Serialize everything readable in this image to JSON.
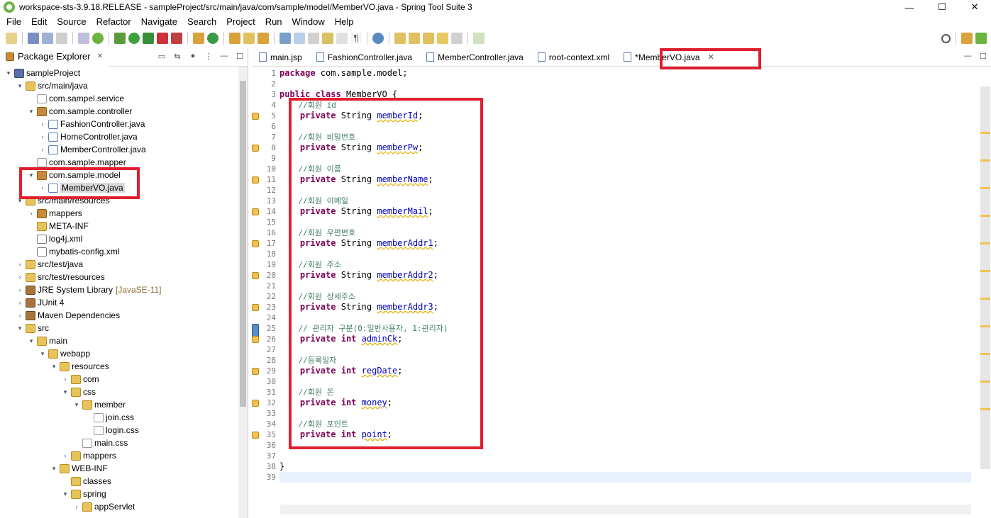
{
  "window": {
    "title": "workspace-sts-3.9.18.RELEASE - sampleProject/src/main/java/com/sample/model/MemberVO.java - Spring Tool Suite 3",
    "minimize": "—",
    "maximize": "☐",
    "close": "✕"
  },
  "menu": [
    "File",
    "Edit",
    "Source",
    "Refactor",
    "Navigate",
    "Search",
    "Project",
    "Run",
    "Window",
    "Help"
  ],
  "package_explorer": {
    "title": "Package Explorer",
    "close": "✕",
    "tree": [
      {
        "label": "sampleProject",
        "icon": "project-icon",
        "twist": "expanded"
      },
      {
        "label": "src/main/java",
        "icon": "source-folder-icon",
        "twist": "expanded"
      },
      {
        "label": "com.sampel.service",
        "icon": "empty-package-icon",
        "twist": ""
      },
      {
        "label": "com.sample.controller",
        "icon": "package-icon",
        "twist": "expanded"
      },
      {
        "label": "FashionController.java",
        "icon": "java-file-icon",
        "twist": "collapsed"
      },
      {
        "label": "HomeController.java",
        "icon": "java-file-icon",
        "twist": "collapsed"
      },
      {
        "label": "MemberController.java",
        "icon": "java-file-icon",
        "twist": "collapsed"
      },
      {
        "label": "com.sample.mapper",
        "icon": "empty-package-icon",
        "twist": ""
      },
      {
        "label": "com.sample.model",
        "icon": "package-icon",
        "twist": "expanded"
      },
      {
        "label": "MemberVO.java",
        "icon": "java-file-icon",
        "twist": "collapsed"
      },
      {
        "label": "src/main/resources",
        "icon": "source-folder-icon",
        "twist": "expanded"
      },
      {
        "label": "mappers",
        "icon": "package-icon",
        "twist": "collapsed"
      },
      {
        "label": "META-INF",
        "icon": "folder-icon",
        "twist": ""
      },
      {
        "label": "log4j.xml",
        "icon": "xml-file-icon",
        "twist": ""
      },
      {
        "label": "mybatis-config.xml",
        "icon": "xml-file-icon",
        "twist": ""
      },
      {
        "label": "src/test/java",
        "icon": "source-folder-icon",
        "twist": "collapsed"
      },
      {
        "label": "src/test/resources",
        "icon": "source-folder-icon",
        "twist": "collapsed"
      },
      {
        "label": "JRE System Library",
        "suffix": "[JavaSE-11]",
        "icon": "library-icon",
        "twist": "collapsed"
      },
      {
        "label": "JUnit 4",
        "icon": "library-icon",
        "twist": "collapsed"
      },
      {
        "label": "Maven Dependencies",
        "icon": "library-icon",
        "twist": "collapsed"
      },
      {
        "label": "src",
        "icon": "folder-icon",
        "twist": "expanded"
      },
      {
        "label": "main",
        "icon": "folder-icon",
        "twist": "expanded"
      },
      {
        "label": "webapp",
        "icon": "folder-icon",
        "twist": "expanded"
      },
      {
        "label": "resources",
        "icon": "folder-icon",
        "twist": "expanded"
      },
      {
        "label": "com",
        "icon": "folder-icon",
        "twist": "collapsed"
      },
      {
        "label": "css",
        "icon": "folder-icon",
        "twist": "expanded"
      },
      {
        "label": "member",
        "icon": "folder-icon",
        "twist": "expanded"
      },
      {
        "label": "join.css",
        "icon": "css-file-icon",
        "twist": ""
      },
      {
        "label": "login.css",
        "icon": "css-file-icon",
        "twist": ""
      },
      {
        "label": "main.css",
        "icon": "css-file-icon",
        "twist": ""
      },
      {
        "label": "mappers",
        "icon": "folder-icon",
        "twist": "collapsed"
      },
      {
        "label": "WEB-INF",
        "icon": "folder-icon",
        "twist": "expanded"
      },
      {
        "label": "classes",
        "icon": "folder-icon",
        "twist": ""
      },
      {
        "label": "spring",
        "icon": "folder-icon",
        "twist": "expanded"
      },
      {
        "label": "appServlet",
        "icon": "folder-icon",
        "twist": "collapsed"
      }
    ]
  },
  "editor_tabs": [
    {
      "label": "main.jsp",
      "icon": "jsp-file-icon"
    },
    {
      "label": "FashionController.java",
      "icon": "java-file-icon"
    },
    {
      "label": "MemberController.java",
      "icon": "java-file-icon"
    },
    {
      "label": "root-context.xml",
      "icon": "xml-file-icon"
    },
    {
      "label": "*MemberVO.java",
      "icon": "java-file-icon",
      "close": "✕"
    }
  ],
  "code_lines": [
    [
      {
        "t": "package",
        "c": "kw"
      },
      {
        "t": " com.sample.model;"
      }
    ],
    [],
    [
      {
        "t": "public",
        "c": "kw"
      },
      {
        "t": " "
      },
      {
        "t": "class",
        "c": "kw"
      },
      {
        "t": " MemberVO {"
      }
    ],
    [
      {
        "t": "    //회원 id",
        "c": "cm"
      }
    ],
    [
      {
        "t": "    "
      },
      {
        "t": "private",
        "c": "kw"
      },
      {
        "t": " String "
      },
      {
        "t": "memberId",
        "c": "fld"
      },
      {
        "t": ";"
      }
    ],
    [],
    [
      {
        "t": "    //회원 비밀번호",
        "c": "cm"
      }
    ],
    [
      {
        "t": "    "
      },
      {
        "t": "private",
        "c": "kw"
      },
      {
        "t": " String "
      },
      {
        "t": "memberPw",
        "c": "fld"
      },
      {
        "t": ";"
      }
    ],
    [],
    [
      {
        "t": "    //회원 이름",
        "c": "cm"
      }
    ],
    [
      {
        "t": "    "
      },
      {
        "t": "private",
        "c": "kw"
      },
      {
        "t": " String "
      },
      {
        "t": "memberName",
        "c": "fld"
      },
      {
        "t": ";"
      }
    ],
    [],
    [
      {
        "t": "    //회원 이메일",
        "c": "cm"
      }
    ],
    [
      {
        "t": "    "
      },
      {
        "t": "private",
        "c": "kw"
      },
      {
        "t": " String "
      },
      {
        "t": "memberMail",
        "c": "fld"
      },
      {
        "t": ";"
      }
    ],
    [],
    [
      {
        "t": "    //회원 우편번호",
        "c": "cm"
      }
    ],
    [
      {
        "t": "    "
      },
      {
        "t": "private",
        "c": "kw"
      },
      {
        "t": " String "
      },
      {
        "t": "memberAddr1",
        "c": "fld"
      },
      {
        "t": ";"
      }
    ],
    [],
    [
      {
        "t": "    //회원 주소",
        "c": "cm"
      }
    ],
    [
      {
        "t": "    "
      },
      {
        "t": "private",
        "c": "kw"
      },
      {
        "t": " String "
      },
      {
        "t": "memberAddr2",
        "c": "fld"
      },
      {
        "t": ";"
      }
    ],
    [],
    [
      {
        "t": "    //회원 상세주소",
        "c": "cm"
      }
    ],
    [
      {
        "t": "    "
      },
      {
        "t": "private",
        "c": "kw"
      },
      {
        "t": " String "
      },
      {
        "t": "memberAddr3",
        "c": "fld"
      },
      {
        "t": ";"
      }
    ],
    [],
    [
      {
        "t": "    // 관리자 구분(0:일반사용자, 1:관리자)",
        "c": "cm"
      }
    ],
    [
      {
        "t": "    "
      },
      {
        "t": "private",
        "c": "kw"
      },
      {
        "t": " "
      },
      {
        "t": "int",
        "c": "kw"
      },
      {
        "t": " "
      },
      {
        "t": "adminCk",
        "c": "fld"
      },
      {
        "t": ";"
      }
    ],
    [],
    [
      {
        "t": "    //등록일자",
        "c": "cm"
      }
    ],
    [
      {
        "t": "    "
      },
      {
        "t": "private",
        "c": "kw"
      },
      {
        "t": " "
      },
      {
        "t": "int",
        "c": "kw"
      },
      {
        "t": " "
      },
      {
        "t": "regDate",
        "c": "fld"
      },
      {
        "t": ";"
      }
    ],
    [],
    [
      {
        "t": "    //회원 돈",
        "c": "cm"
      }
    ],
    [
      {
        "t": "    "
      },
      {
        "t": "private",
        "c": "kw"
      },
      {
        "t": " "
      },
      {
        "t": "int",
        "c": "kw"
      },
      {
        "t": " "
      },
      {
        "t": "money",
        "c": "fld"
      },
      {
        "t": ";"
      }
    ],
    [],
    [
      {
        "t": "    //회원 포인트",
        "c": "cm"
      }
    ],
    [
      {
        "t": "    "
      },
      {
        "t": "private",
        "c": "kw"
      },
      {
        "t": " "
      },
      {
        "t": "int",
        "c": "kw"
      },
      {
        "t": " "
      },
      {
        "t": "point",
        "c": "fld"
      },
      {
        "t": ";"
      }
    ],
    [],
    [],
    [
      {
        "t": "}"
      }
    ],
    []
  ],
  "colors": {
    "keyword": "#7f0055",
    "comment": "#3f7f5f",
    "field": "#0000c0",
    "annotation_box": "#e01e2e"
  }
}
